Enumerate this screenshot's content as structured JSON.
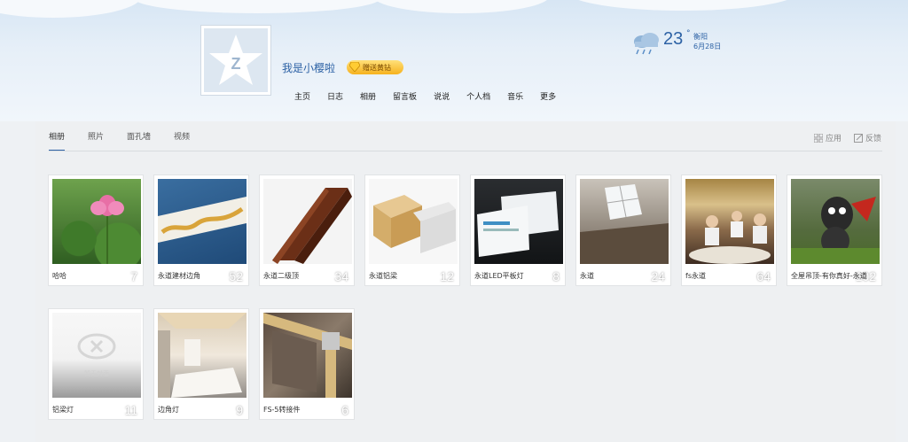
{
  "header": {
    "username": "我是小樱啦",
    "vip_label": "赠送黄钻",
    "nav": [
      "主页",
      "日志",
      "相册",
      "留言板",
      "说说",
      "个人档",
      "音乐",
      "更多"
    ],
    "weather": {
      "temp": "23",
      "degree": "°",
      "city": "衡阳",
      "date": "6月28日"
    }
  },
  "tabs": [
    "相册",
    "照片",
    "面孔墙",
    "视频"
  ],
  "tools": {
    "apps": "应用",
    "feedback": "反馈"
  },
  "albums": [
    {
      "name": "哈哈",
      "count": "7"
    },
    {
      "name": "永道建材边角",
      "count": "52"
    },
    {
      "name": "永道二级顶",
      "count": "34"
    },
    {
      "name": "永道铝梁",
      "count": "12"
    },
    {
      "name": "永道LED平板灯",
      "count": "8"
    },
    {
      "name": "永道",
      "count": "24"
    },
    {
      "name": "fs永道",
      "count": "64"
    },
    {
      "name": "全屋吊顶-有你真好-永道",
      "count": "102"
    },
    {
      "name": "铝梁灯",
      "count": "11",
      "no_cover": "暂无封面"
    },
    {
      "name": "边角灯",
      "count": "9"
    },
    {
      "name": "FS-5转接件",
      "count": "6"
    }
  ],
  "colors": {
    "accent": "#2d62a5",
    "vip": "#f6b21e"
  }
}
